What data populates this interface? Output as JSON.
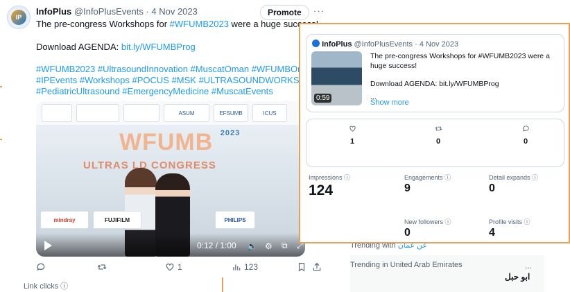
{
  "tweet": {
    "account_name": "InfoPlus",
    "handle_date": "@InfoPlusEvents · 4 Nov 2023",
    "avatar_text": "IP",
    "promote_label": "Promote",
    "more_label": "···",
    "line1_prefix": "The pre-congress Workshops for ",
    "line1_tag": "#WFUMB2023",
    "line1_suffix": " were a huge success!",
    "download_label": "Download AGENDA: ",
    "download_link": "bit.ly/WFUMBProg",
    "hashtags_line1": "#WFUMB2023 #UltrasoundInnovation #MuscatOman #WFUMBOma",
    "hashtags_line2": "#IPEvents #Workshops #POCUS #MSK #ULTRASOUNDWORKSHOP",
    "hashtags_line3": "#PediatricUltrasound #EmergencyMedicine #MuscatEvents",
    "video": {
      "title_text": "WFUMB",
      "title_year": "2023",
      "subtitle_text": "ULTRAS          LD CONGRESS",
      "time": "0:12 / 1:00",
      "sponsors_top": [
        "ASUM",
        "EFSUMB",
        "ICUS"
      ],
      "sponsors_bottom": [
        "mindray",
        "FUJIFILM",
        "PHILIPS"
      ]
    },
    "actions": {
      "reply_count": "",
      "retweet_count": "",
      "like_count": "1",
      "views_count": "123"
    },
    "link_clicks_label": "Link clicks ⓘ"
  },
  "trending": {
    "item1_label": "Trending with",
    "item1_value": "عن عمان",
    "item2_label": "Trending in United Arab Emirates",
    "item2_value": "ابو حبل",
    "more_label": "..."
  },
  "overlay": {
    "account_name": "InfoPlus",
    "handle_date": "@InfoPlusEvents · 4 Nov 2023",
    "text_line1": "The pre-congress Workshops for #WFUMB2023 were a",
    "text_line2": "huge success!",
    "text_line3": "Download AGENDA: bit.ly/WFUMBProg",
    "ellipsis": "...",
    "show_more": "Show more",
    "thumb_time": "0:59",
    "likes": "1",
    "retweets": "0",
    "replies": "0",
    "metrics": {
      "impressions_label": "Impressions ⓘ",
      "impressions_value": "124",
      "engagements_label": "Engagements ⓘ",
      "engagements_value": "9",
      "detail_expands_label": "Detail expands ⓘ",
      "detail_expands_value": "0",
      "new_followers_label": "New followers ⓘ",
      "new_followers_value": "0",
      "profile_visits_label": "Profile visits ⓘ",
      "profile_visits_value": "4"
    }
  },
  "colors": {
    "link": "#1d9bf0",
    "accent_orange": "#e8a15a",
    "text_muted": "#536471"
  }
}
